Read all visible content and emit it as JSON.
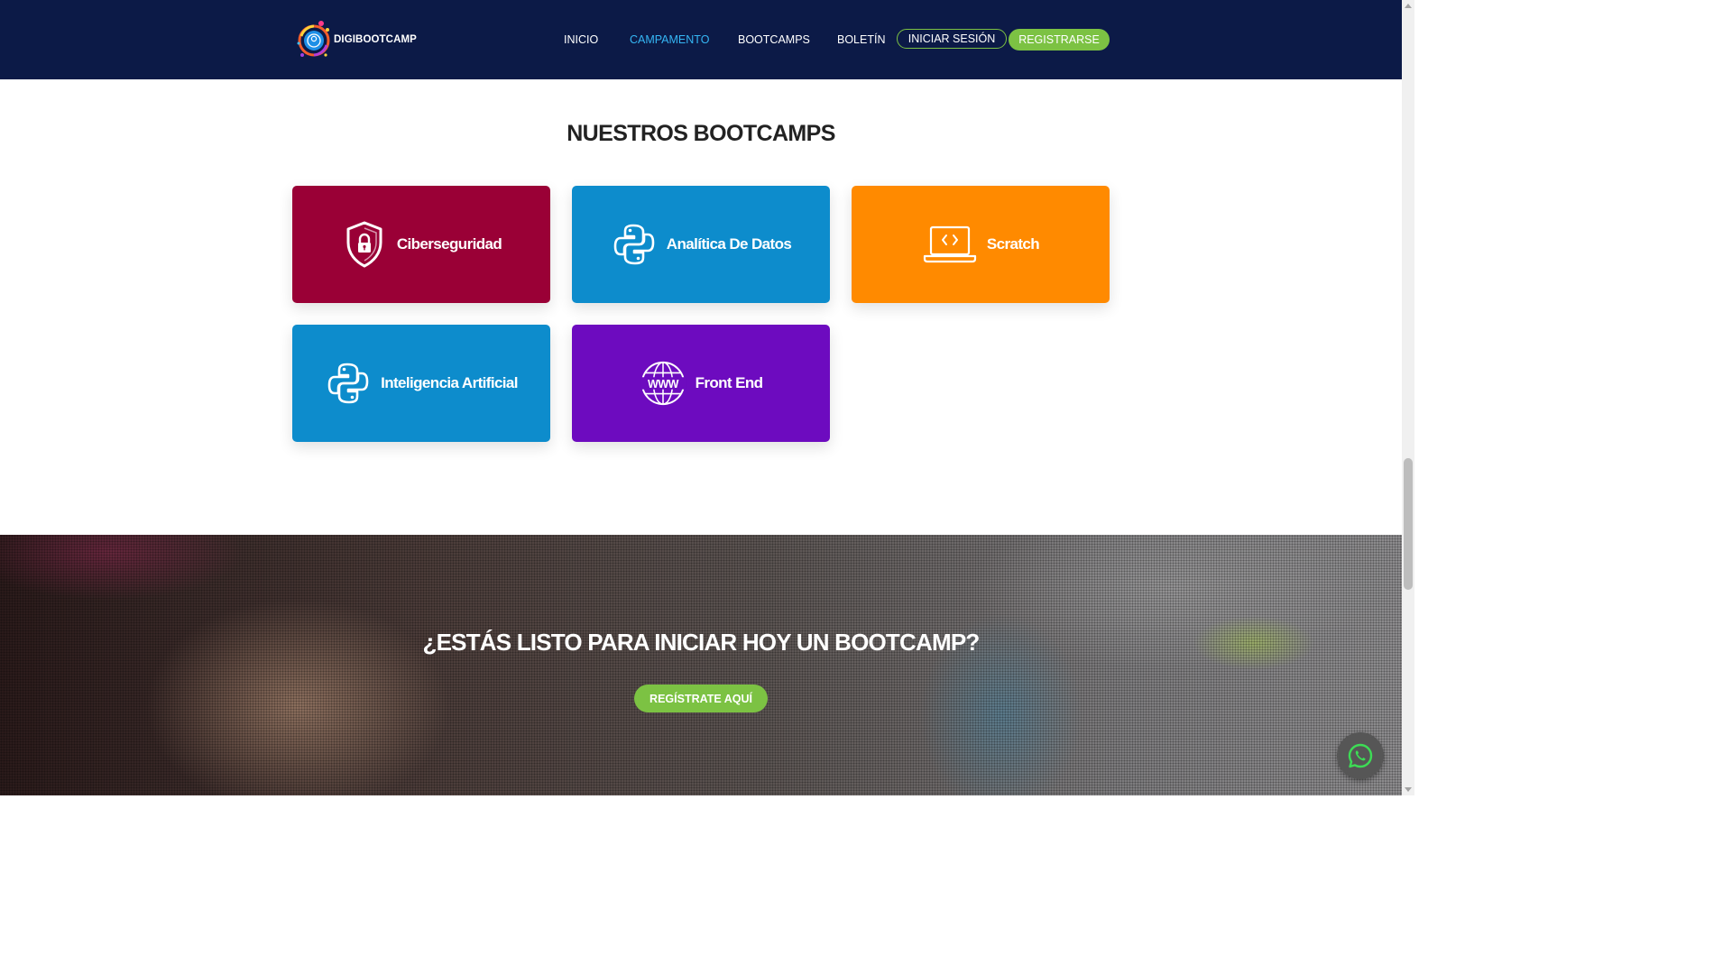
{
  "header": {
    "brand": "DIGIBOOTCAMP",
    "nav": [
      {
        "label": "INICIO",
        "active": false
      },
      {
        "label": "CAMPAMENTO",
        "active": true
      },
      {
        "label": "BOOTCAMPS",
        "active": false
      },
      {
        "label": "BOLETÍN",
        "active": false
      }
    ],
    "login_label": "INICIAR SESIÓN",
    "register_label": "REGISTRARSE"
  },
  "section": {
    "title": "NUESTROS BOOTCAMPS"
  },
  "bootcamps": [
    {
      "label": "Ciberseguridad",
      "icon": "shield-lock-icon",
      "color": "#9a0036"
    },
    {
      "label": "Analítica De Datos",
      "icon": "python-icon",
      "color": "#0d8ccc"
    },
    {
      "label": "Scratch",
      "icon": "laptop-code-icon",
      "color": "#ff8a00"
    },
    {
      "label": "Inteligencia Artificial",
      "icon": "python-icon",
      "color": "#0d8ccc"
    },
    {
      "label": "Front End",
      "icon": "www-globe-icon",
      "color": "#6d0bbf"
    }
  ],
  "cta": {
    "title": "¿ESTÁS LISTO PARA INICIAR HOY UN BOOTCAMP?",
    "button_label": "REGÍSTRATE AQUÍ"
  },
  "colors": {
    "header_bg": "#0c1a47",
    "accent_green": "#7cc243",
    "nav_active": "#35b6f4"
  },
  "floating": {
    "icon": "whatsapp-icon"
  }
}
